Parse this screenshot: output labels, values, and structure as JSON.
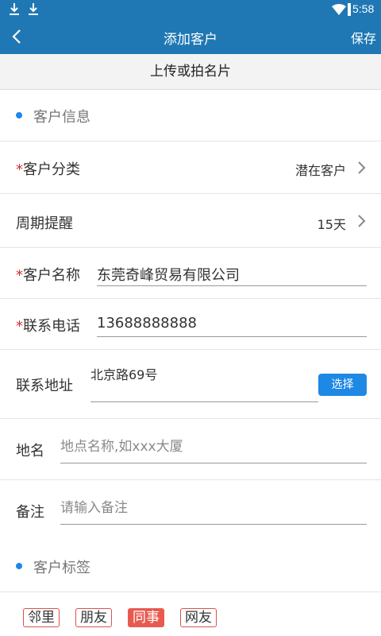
{
  "status_bar": {
    "time": "5:58"
  },
  "header": {
    "title": "添加客户",
    "save_label": "保存"
  },
  "upload": {
    "label": "上传或拍名片"
  },
  "section_info": {
    "title": "客户信息"
  },
  "category": {
    "required": "*",
    "label": "客户分类",
    "value": "潜在客户"
  },
  "cycle": {
    "label": "周期提醒",
    "value": "15天"
  },
  "name": {
    "required": "*",
    "label": "客户名称",
    "value": "东莞奇峰贸易有限公司"
  },
  "phone": {
    "required": "*",
    "label": "联系电话",
    "value": "13688888888"
  },
  "address": {
    "label": "联系地址",
    "value": "北京路69号",
    "select_label": "选择"
  },
  "place": {
    "label": "地名",
    "placeholder": "地点名称,如xxx大厦"
  },
  "remark": {
    "label": "备注",
    "placeholder": "请输入备注"
  },
  "section_tags": {
    "title": "客户标签"
  },
  "tags": [
    {
      "label": "邻里",
      "selected": false
    },
    {
      "label": "朋友",
      "selected": false
    },
    {
      "label": "同事",
      "selected": true
    },
    {
      "label": "网友",
      "selected": false
    }
  ],
  "colors": {
    "primary": "#1f78b4",
    "accent": "#1e88e5",
    "required": "#d32f2f",
    "tag_selected": "#e85a50"
  }
}
